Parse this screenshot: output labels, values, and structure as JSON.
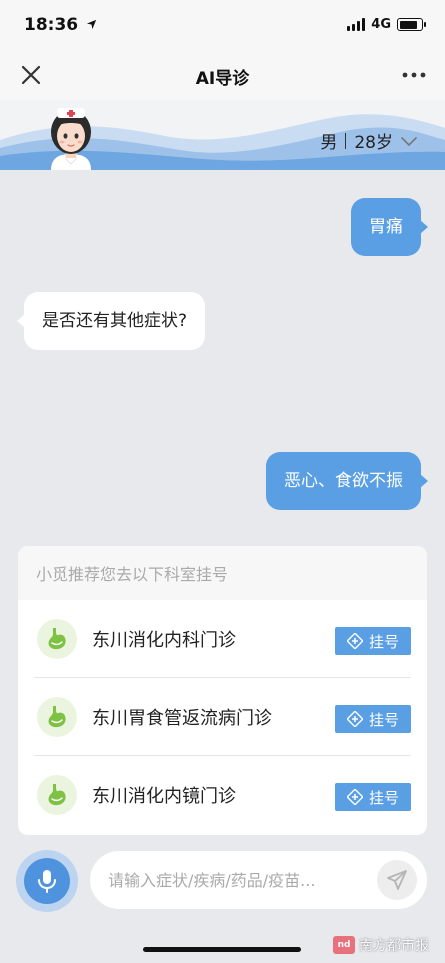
{
  "status_bar": {
    "time": "18:36",
    "network": "4G",
    "battery_level": 0.85
  },
  "nav": {
    "title": "AI导诊",
    "close_icon": "close-icon",
    "more_icon": "more-icon"
  },
  "patient": {
    "gender": "男",
    "age": "28岁"
  },
  "messages": [
    {
      "from": "user",
      "text": "胃痛"
    },
    {
      "from": "bot",
      "text": "是否还有其他症状?"
    },
    {
      "from": "user",
      "text": "恶心、食欲不振"
    }
  ],
  "recommend": {
    "title": "小觅推荐您去以下科室挂号",
    "register_label": "挂号",
    "departments": [
      {
        "name": "东川消化内科门诊"
      },
      {
        "name": "东川胃食管返流病门诊"
      },
      {
        "name": "东川消化内镜门诊"
      }
    ]
  },
  "input": {
    "placeholder": "请输入症状/疾病/药品/疫苗..."
  },
  "watermark": {
    "logo_text": "nd",
    "text": "南方都市报"
  },
  "colors": {
    "accent": "#5a9fe3",
    "background": "#e8e9ed",
    "stomach_icon": "#7dc243"
  }
}
